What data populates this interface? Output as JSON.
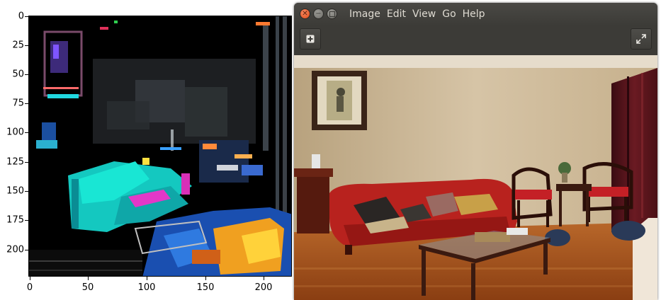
{
  "plot": {
    "y_ticks": [
      "0",
      "25",
      "50",
      "75",
      "100",
      "125",
      "150",
      "175",
      "200"
    ],
    "x_ticks": [
      "0",
      "50",
      "100",
      "150",
      "200"
    ]
  },
  "viewer": {
    "menu": [
      "Image",
      "Edit",
      "View",
      "Go",
      "Help"
    ],
    "icons": {
      "close": "close-icon",
      "minimize": "minimize-icon",
      "maximize": "maximize-icon",
      "sidebar": "sidebar-toggle-icon",
      "fullscreen": "fullscreen-icon"
    }
  },
  "colors": {
    "titlebar": "#3c3b37",
    "close_button": "#df4a16",
    "menu_text": "#dfdbd2",
    "sofa": "#b8221e",
    "wall": "#cbb89c",
    "floor": "#a5561f"
  }
}
